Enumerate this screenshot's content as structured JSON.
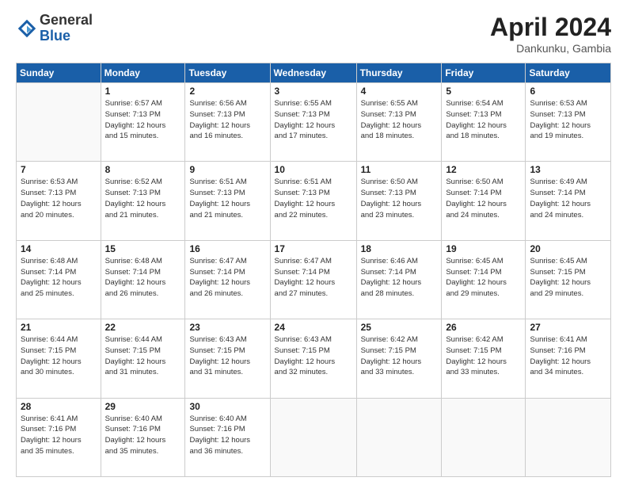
{
  "logo": {
    "general": "General",
    "blue": "Blue"
  },
  "header": {
    "month": "April 2024",
    "location": "Dankunku, Gambia"
  },
  "weekdays": [
    "Sunday",
    "Monday",
    "Tuesday",
    "Wednesday",
    "Thursday",
    "Friday",
    "Saturday"
  ],
  "weeks": [
    [
      {
        "day": "",
        "sunrise": "",
        "sunset": "",
        "daylight": ""
      },
      {
        "day": "1",
        "sunrise": "Sunrise: 6:57 AM",
        "sunset": "Sunset: 7:13 PM",
        "daylight": "Daylight: 12 hours and 15 minutes."
      },
      {
        "day": "2",
        "sunrise": "Sunrise: 6:56 AM",
        "sunset": "Sunset: 7:13 PM",
        "daylight": "Daylight: 12 hours and 16 minutes."
      },
      {
        "day": "3",
        "sunrise": "Sunrise: 6:55 AM",
        "sunset": "Sunset: 7:13 PM",
        "daylight": "Daylight: 12 hours and 17 minutes."
      },
      {
        "day": "4",
        "sunrise": "Sunrise: 6:55 AM",
        "sunset": "Sunset: 7:13 PM",
        "daylight": "Daylight: 12 hours and 18 minutes."
      },
      {
        "day": "5",
        "sunrise": "Sunrise: 6:54 AM",
        "sunset": "Sunset: 7:13 PM",
        "daylight": "Daylight: 12 hours and 18 minutes."
      },
      {
        "day": "6",
        "sunrise": "Sunrise: 6:53 AM",
        "sunset": "Sunset: 7:13 PM",
        "daylight": "Daylight: 12 hours and 19 minutes."
      }
    ],
    [
      {
        "day": "7",
        "sunrise": "Sunrise: 6:53 AM",
        "sunset": "Sunset: 7:13 PM",
        "daylight": "Daylight: 12 hours and 20 minutes."
      },
      {
        "day": "8",
        "sunrise": "Sunrise: 6:52 AM",
        "sunset": "Sunset: 7:13 PM",
        "daylight": "Daylight: 12 hours and 21 minutes."
      },
      {
        "day": "9",
        "sunrise": "Sunrise: 6:51 AM",
        "sunset": "Sunset: 7:13 PM",
        "daylight": "Daylight: 12 hours and 21 minutes."
      },
      {
        "day": "10",
        "sunrise": "Sunrise: 6:51 AM",
        "sunset": "Sunset: 7:13 PM",
        "daylight": "Daylight: 12 hours and 22 minutes."
      },
      {
        "day": "11",
        "sunrise": "Sunrise: 6:50 AM",
        "sunset": "Sunset: 7:13 PM",
        "daylight": "Daylight: 12 hours and 23 minutes."
      },
      {
        "day": "12",
        "sunrise": "Sunrise: 6:50 AM",
        "sunset": "Sunset: 7:14 PM",
        "daylight": "Daylight: 12 hours and 24 minutes."
      },
      {
        "day": "13",
        "sunrise": "Sunrise: 6:49 AM",
        "sunset": "Sunset: 7:14 PM",
        "daylight": "Daylight: 12 hours and 24 minutes."
      }
    ],
    [
      {
        "day": "14",
        "sunrise": "Sunrise: 6:48 AM",
        "sunset": "Sunset: 7:14 PM",
        "daylight": "Daylight: 12 hours and 25 minutes."
      },
      {
        "day": "15",
        "sunrise": "Sunrise: 6:48 AM",
        "sunset": "Sunset: 7:14 PM",
        "daylight": "Daylight: 12 hours and 26 minutes."
      },
      {
        "day": "16",
        "sunrise": "Sunrise: 6:47 AM",
        "sunset": "Sunset: 7:14 PM",
        "daylight": "Daylight: 12 hours and 26 minutes."
      },
      {
        "day": "17",
        "sunrise": "Sunrise: 6:47 AM",
        "sunset": "Sunset: 7:14 PM",
        "daylight": "Daylight: 12 hours and 27 minutes."
      },
      {
        "day": "18",
        "sunrise": "Sunrise: 6:46 AM",
        "sunset": "Sunset: 7:14 PM",
        "daylight": "Daylight: 12 hours and 28 minutes."
      },
      {
        "day": "19",
        "sunrise": "Sunrise: 6:45 AM",
        "sunset": "Sunset: 7:14 PM",
        "daylight": "Daylight: 12 hours and 29 minutes."
      },
      {
        "day": "20",
        "sunrise": "Sunrise: 6:45 AM",
        "sunset": "Sunset: 7:15 PM",
        "daylight": "Daylight: 12 hours and 29 minutes."
      }
    ],
    [
      {
        "day": "21",
        "sunrise": "Sunrise: 6:44 AM",
        "sunset": "Sunset: 7:15 PM",
        "daylight": "Daylight: 12 hours and 30 minutes."
      },
      {
        "day": "22",
        "sunrise": "Sunrise: 6:44 AM",
        "sunset": "Sunset: 7:15 PM",
        "daylight": "Daylight: 12 hours and 31 minutes."
      },
      {
        "day": "23",
        "sunrise": "Sunrise: 6:43 AM",
        "sunset": "Sunset: 7:15 PM",
        "daylight": "Daylight: 12 hours and 31 minutes."
      },
      {
        "day": "24",
        "sunrise": "Sunrise: 6:43 AM",
        "sunset": "Sunset: 7:15 PM",
        "daylight": "Daylight: 12 hours and 32 minutes."
      },
      {
        "day": "25",
        "sunrise": "Sunrise: 6:42 AM",
        "sunset": "Sunset: 7:15 PM",
        "daylight": "Daylight: 12 hours and 33 minutes."
      },
      {
        "day": "26",
        "sunrise": "Sunrise: 6:42 AM",
        "sunset": "Sunset: 7:15 PM",
        "daylight": "Daylight: 12 hours and 33 minutes."
      },
      {
        "day": "27",
        "sunrise": "Sunrise: 6:41 AM",
        "sunset": "Sunset: 7:16 PM",
        "daylight": "Daylight: 12 hours and 34 minutes."
      }
    ],
    [
      {
        "day": "28",
        "sunrise": "Sunrise: 6:41 AM",
        "sunset": "Sunset: 7:16 PM",
        "daylight": "Daylight: 12 hours and 35 minutes."
      },
      {
        "day": "29",
        "sunrise": "Sunrise: 6:40 AM",
        "sunset": "Sunset: 7:16 PM",
        "daylight": "Daylight: 12 hours and 35 minutes."
      },
      {
        "day": "30",
        "sunrise": "Sunrise: 6:40 AM",
        "sunset": "Sunset: 7:16 PM",
        "daylight": "Daylight: 12 hours and 36 minutes."
      },
      {
        "day": "",
        "sunrise": "",
        "sunset": "",
        "daylight": ""
      },
      {
        "day": "",
        "sunrise": "",
        "sunset": "",
        "daylight": ""
      },
      {
        "day": "",
        "sunrise": "",
        "sunset": "",
        "daylight": ""
      },
      {
        "day": "",
        "sunrise": "",
        "sunset": "",
        "daylight": ""
      }
    ]
  ]
}
